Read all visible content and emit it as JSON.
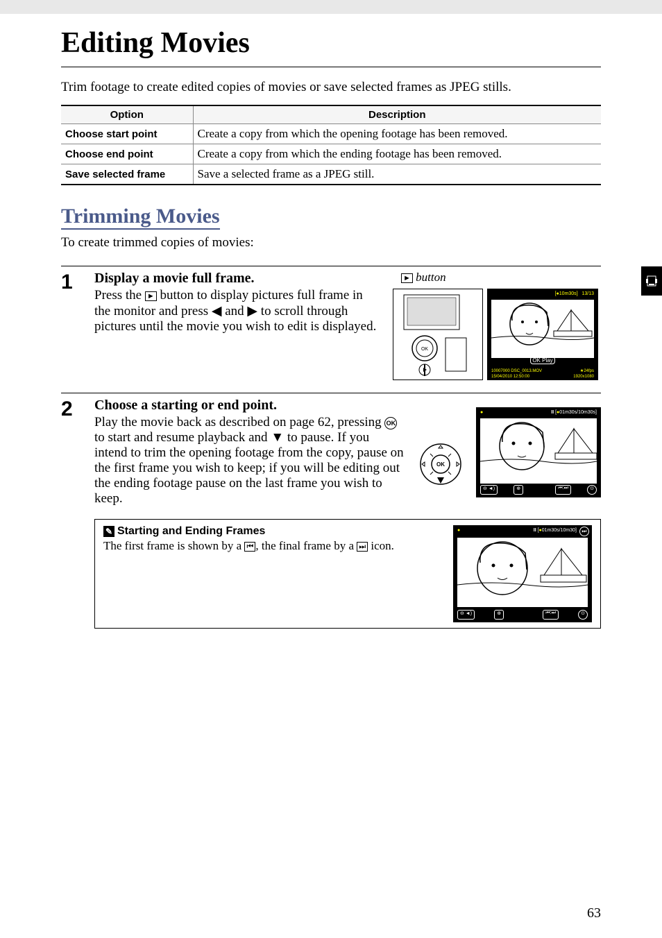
{
  "page": {
    "title": "Editing Movies",
    "intro": "Trim footage to create edited copies of movies or save selected frames as JPEG stills.",
    "pageNumber": 63
  },
  "table": {
    "headers": [
      "Option",
      "Description"
    ],
    "rows": [
      {
        "option": "Choose start point",
        "desc": "Create a copy from which the opening footage has been removed."
      },
      {
        "option": "Choose end point",
        "desc": "Create a copy from which the ending footage has been removed."
      },
      {
        "option": "Save selected frame",
        "desc": "Save a selected frame as a JPEG still."
      }
    ]
  },
  "section": {
    "title": "Trimming Movies",
    "intro": "To create trimmed copies of movies:"
  },
  "steps": [
    {
      "num": "1",
      "title": "Display a movie full frame.",
      "body1": "Press the ",
      "body2": " button to display pictures full frame in the monitor and press ",
      "body3": " and ",
      "body4": " to scroll through pictures until the movie you wish to edit is displayed.",
      "figLabel1": " button",
      "screenInfo": {
        "topTime": "10m30s",
        "counter": "13/13",
        "okPlay": "OK Play",
        "bottomLine1": "10007000  DSC_0013.MOV",
        "bottomLine2": "15/04/2010 12:50:00",
        "fps": "24fps",
        "res": "1920x1080"
      }
    },
    {
      "num": "2",
      "title": "Choose a starting or end point.",
      "body1": "Play the movie back as described on page 62, pressing ",
      "body2": " to start and resume playback and ",
      "body3": " to pause.  If you intend to trim the opening footage from the copy, pause on the first frame you wish to keep; if you will be editing out the ending footage pause on the last frame you wish to keep.",
      "screenInfo": {
        "timecode": "01m30s/10m30s"
      }
    }
  ],
  "note": {
    "title": "Starting and Ending Frames",
    "body1": "The first frame is shown by a ",
    "body2": ", the final frame by a ",
    "body3": " icon.",
    "screenInfo": {
      "timecode": "01m30s/10m30"
    }
  },
  "icons": {
    "playback": "►",
    "left": "◀",
    "right": "▶",
    "down": "▼",
    "ok": "OK",
    "pencil": "✎",
    "firstFrame": "⏮",
    "lastFrame": "⏭",
    "pause": "II"
  }
}
